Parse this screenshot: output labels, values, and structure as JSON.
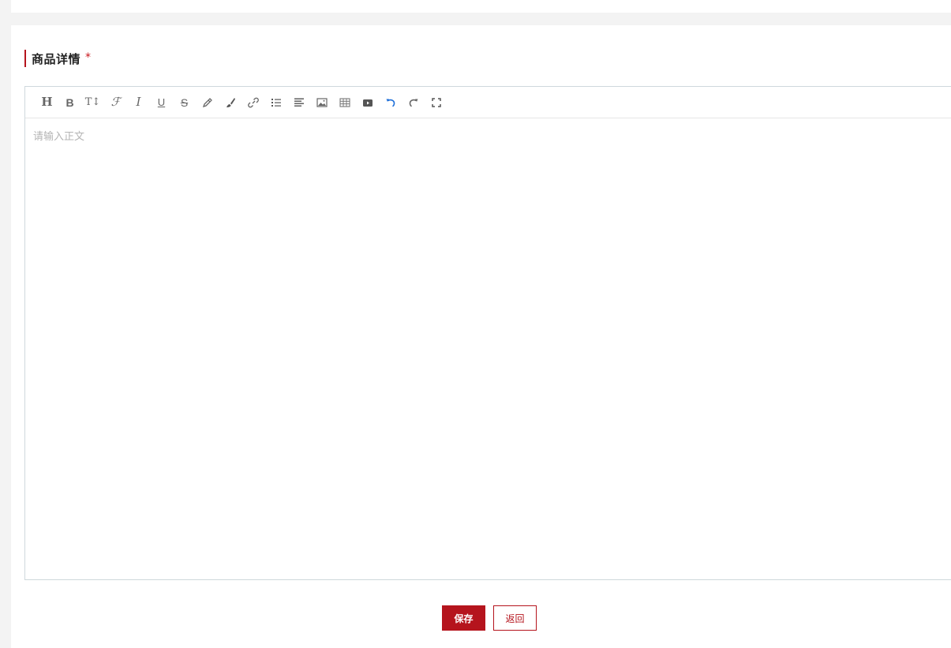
{
  "section": {
    "title": "商品详情",
    "required_mark": "*"
  },
  "editor": {
    "placeholder": "请输入正文",
    "toolbar": [
      {
        "icon": "heading-icon",
        "glyph": "H"
      },
      {
        "icon": "bold-icon",
        "glyph": "B"
      },
      {
        "icon": "font-size-icon",
        "glyph": "T↕"
      },
      {
        "icon": "font-family-icon",
        "glyph": "ℱ"
      },
      {
        "icon": "italic-icon",
        "glyph": "I"
      },
      {
        "icon": "underline-icon",
        "glyph": "U"
      },
      {
        "icon": "strikethrough-icon",
        "glyph": "S"
      },
      {
        "icon": "font-color-icon",
        "glyph": ""
      },
      {
        "icon": "background-color-icon",
        "glyph": ""
      },
      {
        "icon": "link-icon",
        "glyph": ""
      },
      {
        "icon": "list-icon",
        "glyph": ""
      },
      {
        "icon": "align-icon",
        "glyph": ""
      },
      {
        "icon": "image-icon",
        "glyph": ""
      },
      {
        "icon": "table-icon",
        "glyph": ""
      },
      {
        "icon": "video-icon",
        "glyph": ""
      },
      {
        "icon": "undo-icon",
        "glyph": ""
      },
      {
        "icon": "redo-icon",
        "glyph": ""
      },
      {
        "icon": "fullscreen-icon",
        "glyph": ""
      }
    ]
  },
  "actions": {
    "save_label": "保存",
    "back_label": "返回"
  },
  "colors": {
    "accent": "#b5141d",
    "undo_accent": "#1e6fd9"
  }
}
